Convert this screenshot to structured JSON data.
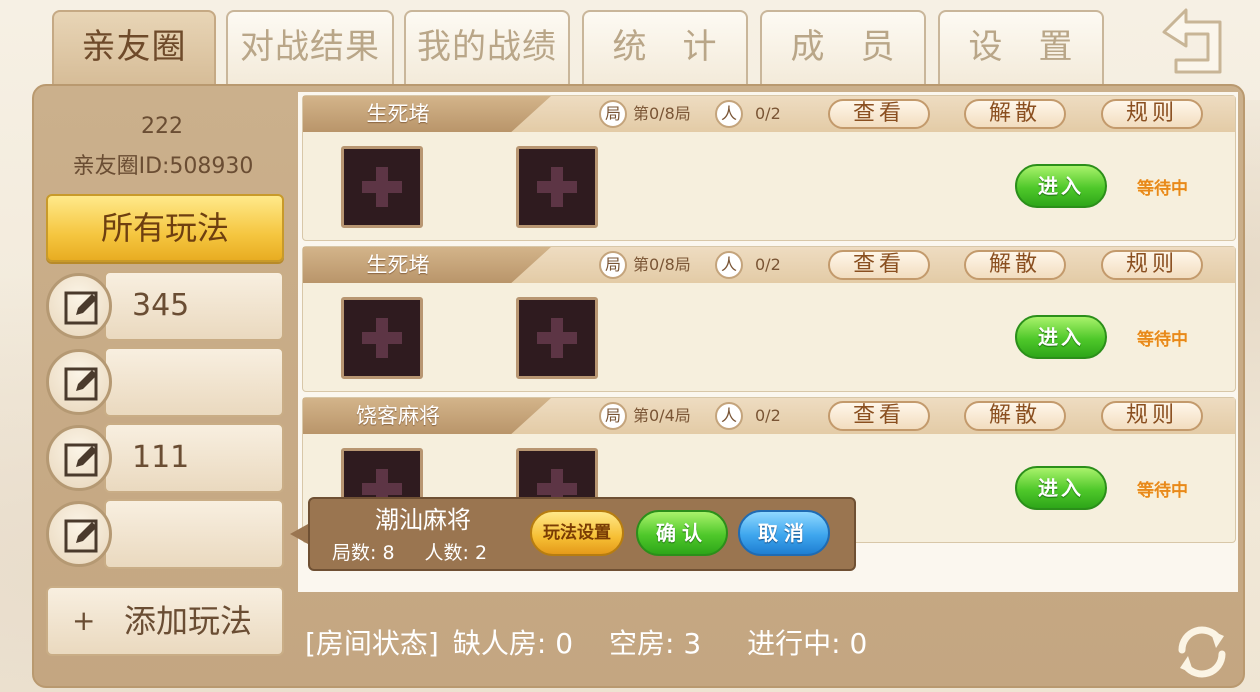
{
  "tabs": [
    {
      "label": "亲友圈",
      "active": true
    },
    {
      "label": "对战结果",
      "active": false
    },
    {
      "label": "我的战绩",
      "active": false
    },
    {
      "label": "统　计",
      "active": false
    },
    {
      "label": "成　员",
      "active": false
    },
    {
      "label": "设　置",
      "active": false
    }
  ],
  "sidebar": {
    "club_name": "222",
    "club_id": "亲友圈ID:508930",
    "all_modes_label": "所有玩法",
    "modes": [
      {
        "label": "345"
      },
      {
        "label": ""
      },
      {
        "label": "111"
      },
      {
        "label": ""
      }
    ],
    "add_mode_plus": "+",
    "add_mode_label": "添加玩法"
  },
  "rooms": [
    {
      "title": "生死堵",
      "round_icon": "局",
      "round_text": "第0/8局",
      "people_icon": "人",
      "people_text": "0/2",
      "view_label": "查看",
      "dissolve_label": "解散",
      "rules_label": "规则",
      "enter_label": "进入",
      "status": "等待中"
    },
    {
      "title": "生死堵",
      "round_icon": "局",
      "round_text": "第0/8局",
      "people_icon": "人",
      "people_text": "0/2",
      "view_label": "查看",
      "dissolve_label": "解散",
      "rules_label": "规则",
      "enter_label": "进入",
      "status": "等待中"
    },
    {
      "title": "饶客麻将",
      "round_icon": "局",
      "round_text": "第0/4局",
      "people_icon": "人",
      "people_text": "0/2",
      "view_label": "查看",
      "dissolve_label": "解散",
      "rules_label": "规则",
      "enter_label": "进入",
      "status": "等待中"
    }
  ],
  "popup": {
    "name": "潮汕麻将",
    "rounds": "局数: 8",
    "players": "人数: 2",
    "settings_label": "玩法设置",
    "confirm_label": "确认",
    "cancel_label": "取消"
  },
  "room_status": {
    "prefix": "[房间状态]",
    "short": "缺人房: 0",
    "empty": "空房: 3",
    "in_progress": "进行中: 0"
  },
  "icons": [
    "back-arrow-icon",
    "edit-icon",
    "add-seat-icon",
    "refresh-icon"
  ]
}
